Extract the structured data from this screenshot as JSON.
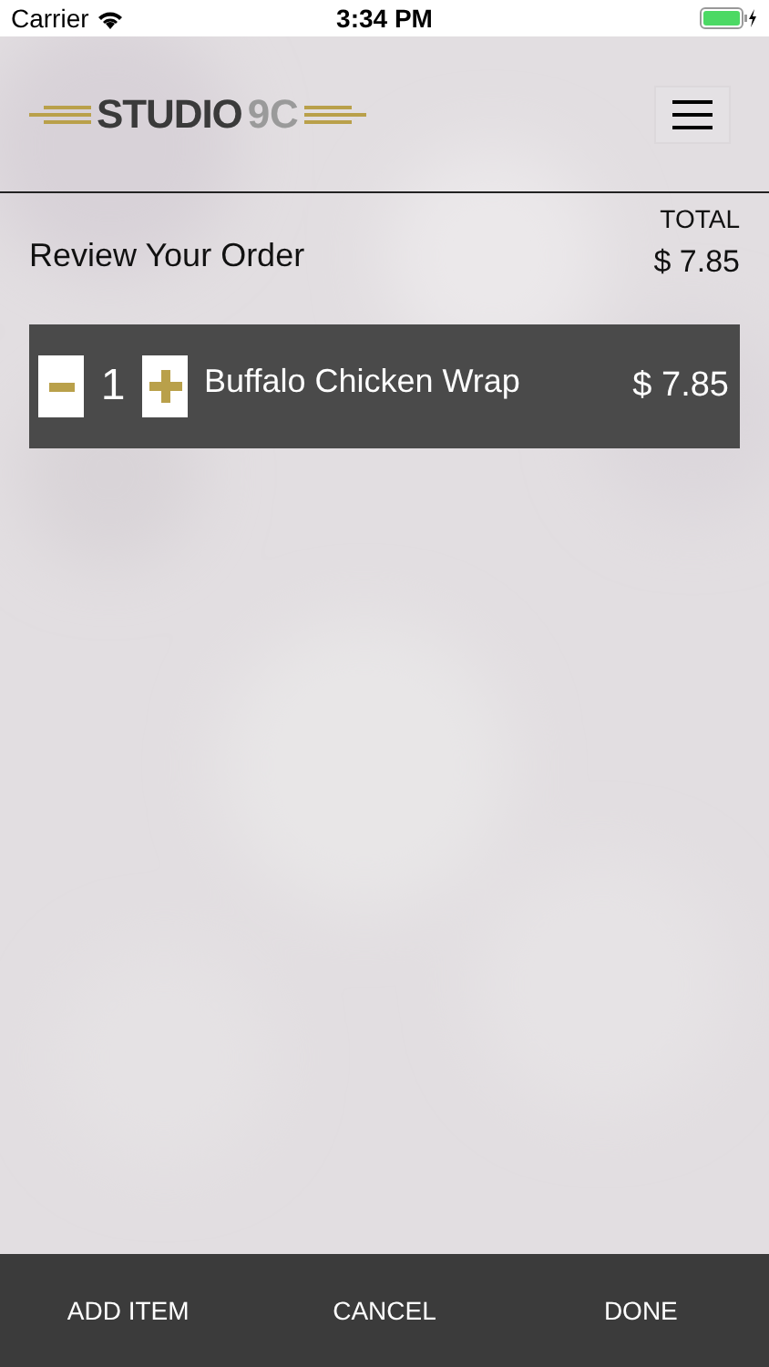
{
  "status_bar": {
    "carrier": "Carrier",
    "time": "3:34 PM"
  },
  "logo": {
    "word": "STUDIO",
    "suffix": "9C"
  },
  "order": {
    "title": "Review Your Order",
    "total_label": "TOTAL",
    "total": "$ 7.85"
  },
  "items": [
    {
      "quantity": "1",
      "name": "Buffalo Chicken Wrap",
      "price": "$ 7.85"
    }
  ],
  "footer_buttons": [
    "ADD ITEM",
    "CANCEL",
    "DONE"
  ]
}
